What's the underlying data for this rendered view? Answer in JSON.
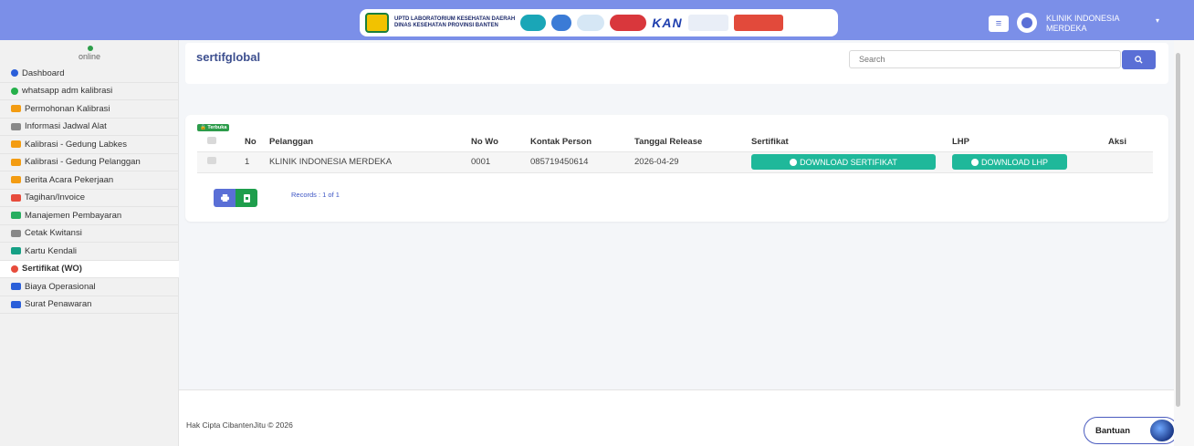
{
  "banner": {
    "line1": "UPTD LABORATORIUM KESEHATAN DAERAH",
    "line2": "DINAS KESEHATAN PROVINSI BANTEN",
    "kan": "KAN"
  },
  "user": {
    "name": "KLINIK INDONESIA MERDEKA"
  },
  "sidebar": {
    "status": "online",
    "items": [
      {
        "label": "Dashboard",
        "icon": "dashboard-icon",
        "color": "#2b5fd9"
      },
      {
        "label": "whatsapp adm kalibrasi",
        "icon": "whatsapp-icon",
        "color": "#25b04a"
      },
      {
        "label": "Permohonan Kalibrasi",
        "icon": "folder-icon",
        "color": "#f39c12"
      },
      {
        "label": "Informasi Jadwal Alat",
        "icon": "calendar-icon",
        "color": "#888888"
      },
      {
        "label": "Kalibrasi - Gedung Labkes",
        "icon": "folder-open-icon",
        "color": "#f39c12"
      },
      {
        "label": "Kalibrasi - Gedung Pelanggan",
        "icon": "folder-open-icon",
        "color": "#f39c12"
      },
      {
        "label": "Berita Acara Pekerjaan",
        "icon": "folder-icon",
        "color": "#f39c12"
      },
      {
        "label": "Tagihan/Invoice",
        "icon": "invoice-icon",
        "color": "#e74c3c"
      },
      {
        "label": "Manajemen Pembayaran",
        "icon": "money-icon",
        "color": "#27ae60"
      },
      {
        "label": "Cetak Kwitansi",
        "icon": "print-icon",
        "color": "#888888"
      },
      {
        "label": "Kartu Kendali",
        "icon": "card-icon",
        "color": "#16a085"
      },
      {
        "label": "Sertifikat (WO)",
        "icon": "certificate-icon",
        "color": "#e74c3c",
        "active": true
      },
      {
        "label": "Biaya Operasional",
        "icon": "calculator-icon",
        "color": "#2b5fd9"
      },
      {
        "label": "Surat Penawaran",
        "icon": "send-icon",
        "color": "#2b5fd9"
      }
    ]
  },
  "page": {
    "title": "sertifglobal",
    "search_placeholder": "Search"
  },
  "table": {
    "badge": "Terbuka",
    "headers": [
      "No",
      "Pelanggan",
      "No Wo",
      "Kontak Person",
      "Tanggal Release",
      "Sertifikat",
      "LHP",
      "Aksi"
    ],
    "rows": [
      {
        "no": "1",
        "pelanggan": "KLINIK INDONESIA MERDEKA",
        "no_wo": "0001",
        "kontak": "085719450614",
        "tanggal": "2026-04-29",
        "sertifikat_btn": "DOWNLOAD SERTIFIKAT",
        "lhp_btn": "DOWNLOAD LHP"
      }
    ],
    "records": "Records : 1 of 1"
  },
  "footer": {
    "copyright": "Hak Cipta CibantenJitu © 2026",
    "help": "Bantuan"
  },
  "colors": {
    "navbar": "#7b8fe8",
    "primary": "#5a6fd6",
    "success": "#1fb89a",
    "excel": "#1e9e4c"
  }
}
